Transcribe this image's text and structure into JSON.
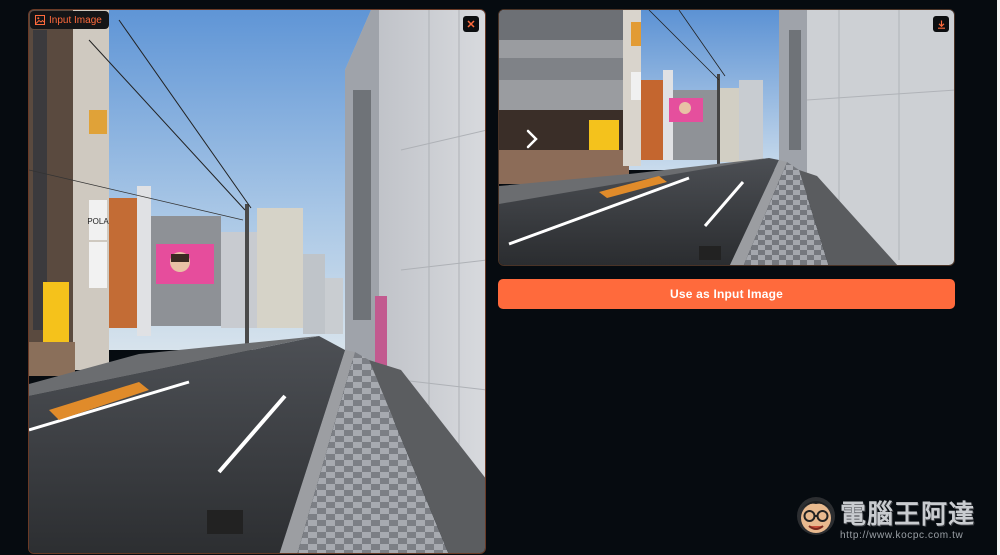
{
  "input_panel": {
    "tag_label": "Input Image",
    "tag_icon": "image-icon",
    "close_icon": "close-icon",
    "billboard_text": "POLA"
  },
  "result_panel": {
    "download_icon": "download-icon",
    "next_icon": "chevron-right-icon"
  },
  "actions": {
    "use_as_input_label": "Use as Input Image"
  },
  "watermark": {
    "title": "電腦王阿達",
    "url": "http://www.kocpc.com.tw"
  },
  "colors": {
    "accent": "#ff6a3c",
    "background": "#060b10"
  }
}
